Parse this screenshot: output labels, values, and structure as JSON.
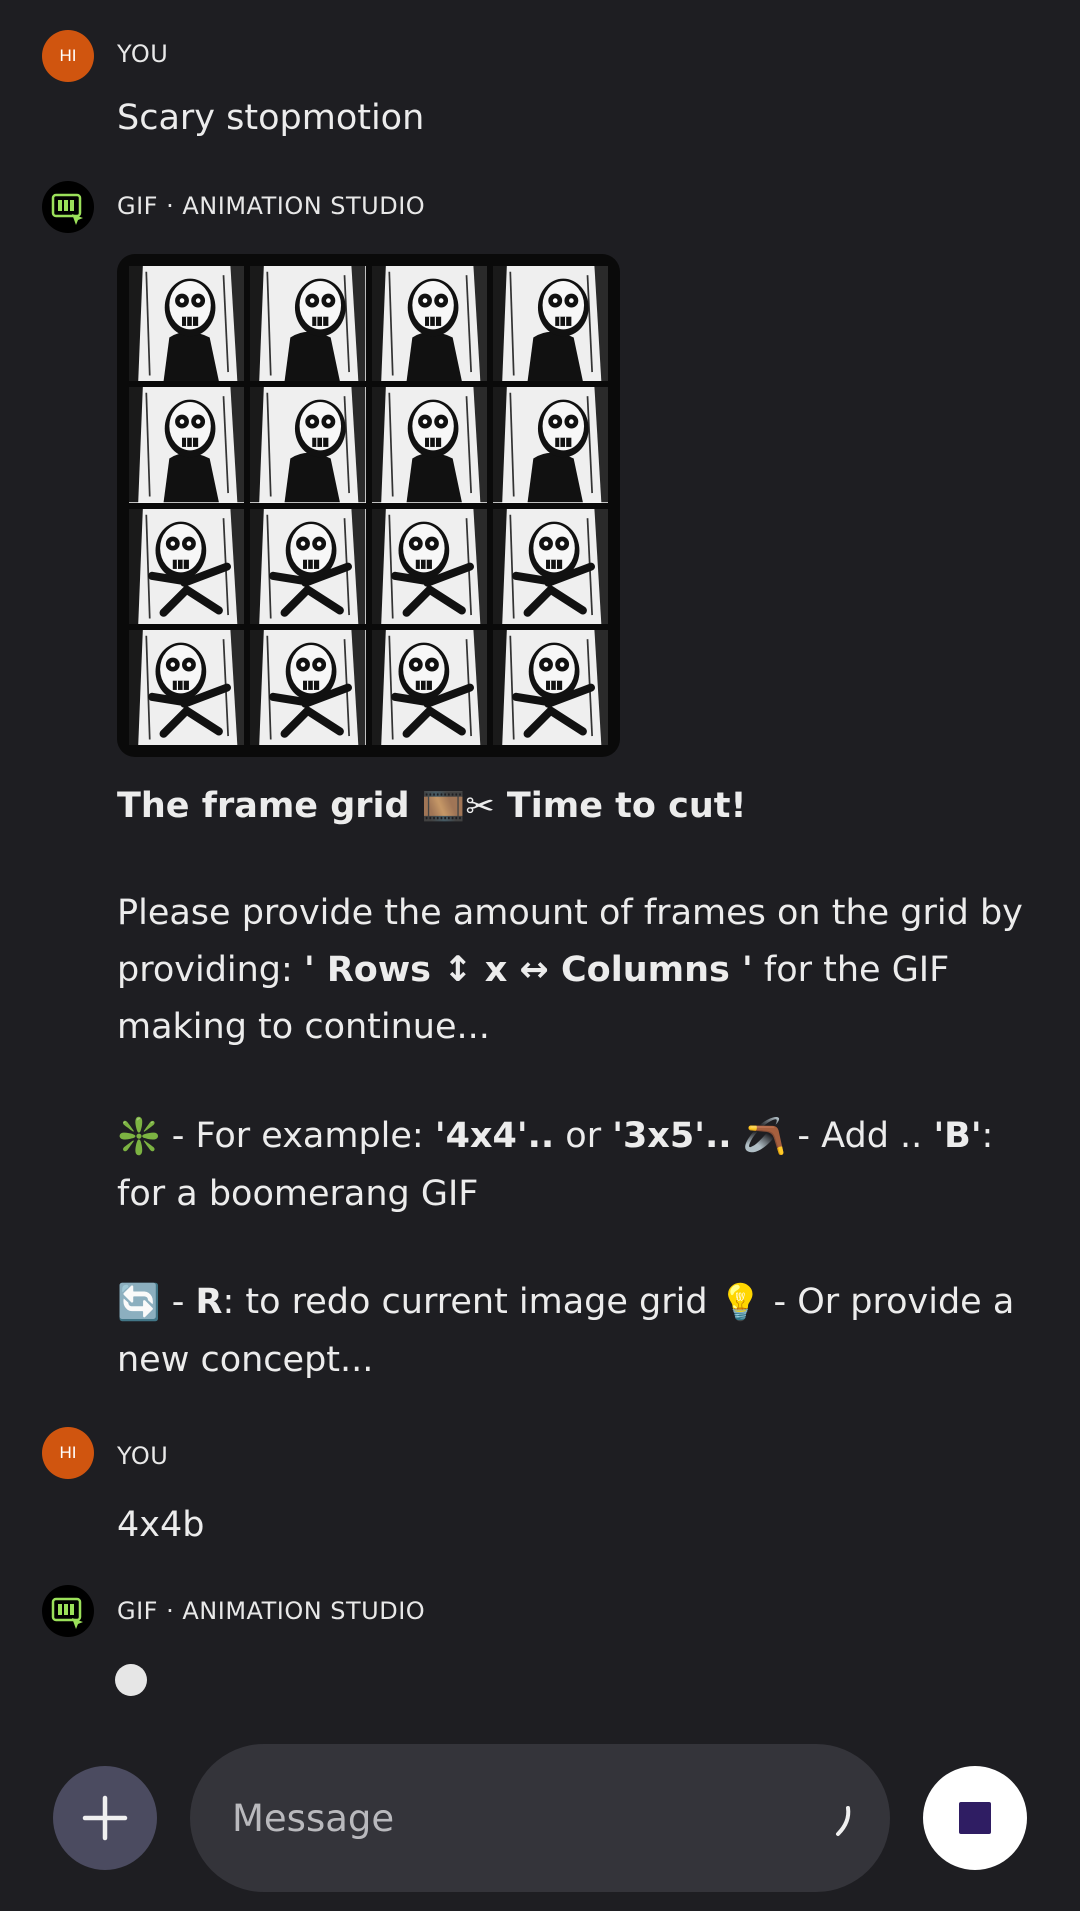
{
  "messages": [
    {
      "sender": "YOU",
      "avatar_initials": "HI",
      "text": "Scary stopmotion"
    },
    {
      "sender": "GIF · ANIMATION STUDIO"
    },
    {
      "sender": "YOU",
      "avatar_initials": "HI",
      "text": "4x4b"
    },
    {
      "sender": "GIF · ANIMATION STUDIO"
    }
  ],
  "reply": {
    "title_a": "The frame grid ",
    "title_film": "🎞️",
    "title_scissors": "✂",
    "title_b": " Time to cut!",
    "p1_a": "Please provide the amount of frames on the grid by providing: ",
    "p1_rows": "' Rows ↕ x ↔ Columns '",
    "p1_b": " for the GIF making to continue...",
    "p2_emoji": "❇️",
    "p2_a": " - For example: ",
    "p2_ex1": "'4x4'..",
    "p2_b": "  or ",
    "p2_ex2": "'3x5'..",
    "p2_c": " ",
    "p2_boomerang": "🪃",
    "p2_d": " - Add .. ",
    "p2_B": "'B'",
    "p2_e": ": for a boomerang GIF",
    "p3_emoji": "🔄",
    "p3_a": " - ",
    "p3_R": "R",
    "p3_b": ": to redo current image grid ",
    "p3_bulb": "💡",
    "p3_c": " -  Or provide a new concept..."
  },
  "image_grid": {
    "rows": 4,
    "columns": 4
  },
  "composer": {
    "placeholder": "Message"
  },
  "colors": {
    "background": "#1e1e22",
    "user_avatar": "#d0550f",
    "bot_icon": "#9be05a",
    "stop_square": "#2f1d63"
  },
  "icons": [
    "bot-avatar-icon",
    "plus-icon",
    "stop-icon",
    "voice-icon"
  ]
}
